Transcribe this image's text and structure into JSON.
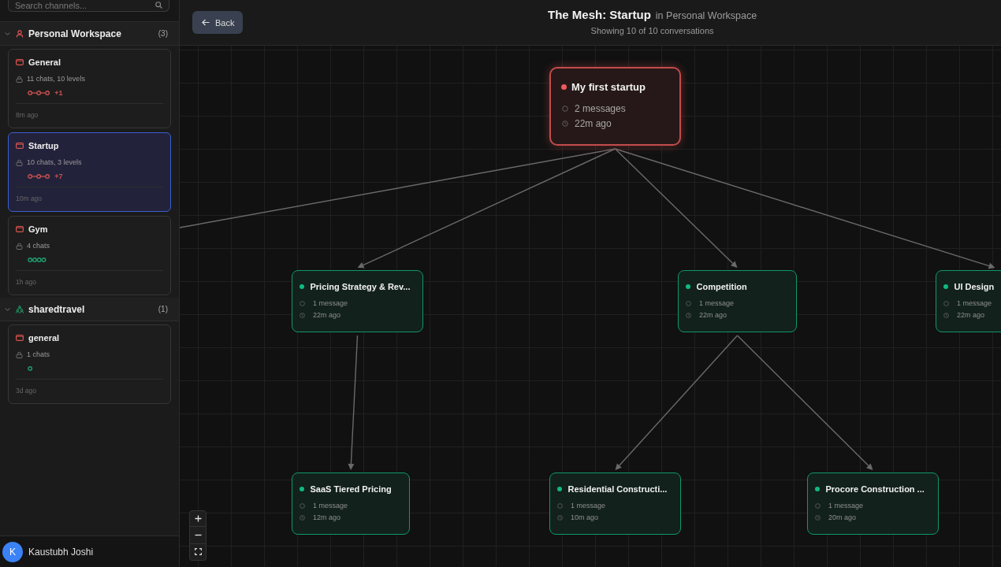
{
  "sidebar": {
    "search": {
      "placeholder": "Search channels..."
    },
    "groups": [
      {
        "kind": "personal",
        "name": "Personal Workspace",
        "count": "(3)",
        "expanded": true,
        "channels": [
          {
            "name": "General",
            "summary": "11 chats, 10 levels",
            "preview": {
              "linked": true,
              "dots": [
                {
                  "color": "#c8504e"
                },
                {
                  "color": "#c8504e"
                },
                {
                  "color": "#c8504e"
                }
              ],
              "extra": "+1"
            },
            "time": "8m ago",
            "selected": false
          },
          {
            "name": "Startup",
            "summary": "10 chats, 3 levels",
            "preview": {
              "linked": true,
              "dots": [
                {
                  "color": "#c8504e"
                },
                {
                  "color": "#c8504e"
                },
                {
                  "color": "#c8504e"
                }
              ],
              "extra": "+7"
            },
            "time": "10m ago",
            "selected": true
          },
          {
            "name": "Gym",
            "summary": "4 chats",
            "preview": {
              "linked": false,
              "dots": [
                {
                  "color": "#1f9d6e"
                },
                {
                  "color": "#1f9d6e"
                },
                {
                  "color": "#1f9d6e"
                },
                {
                  "color": "#1f9d6e"
                }
              ]
            },
            "time": "1h ago",
            "selected": false
          }
        ]
      },
      {
        "kind": "shared",
        "name": "sharedtravel",
        "count": "(1)",
        "expanded": true,
        "channels": [
          {
            "name": "general",
            "summary": "1 chats",
            "preview": {
              "linked": false,
              "dots": [
                {
                  "color": "#1f9d6e"
                }
              ]
            },
            "time": "3d ago",
            "selected": false
          }
        ]
      }
    ],
    "user": {
      "initial": "K",
      "name": "Kaustubh Joshi"
    }
  },
  "main": {
    "back_button": {
      "label": "Back"
    },
    "title": "The Mesh: Startup",
    "context": "in Personal Workspace",
    "subtitle": "Showing 10 of 10 conversations",
    "mesh": {
      "nodes": [
        {
          "title": "My first startup",
          "messages": "2 messages",
          "time": "22m ago",
          "color": "#f05a5a",
          "children": [
            {
              "title": "Pricing Strategy & Rev...",
              "messages": "1 message",
              "time": "22m ago",
              "color": "#10b981",
              "children": [
                {
                  "title": "SaaS Tiered Pricing",
                  "messages": "1 message",
                  "time": "12m ago",
                  "color": "#10b981"
                }
              ]
            },
            {
              "title": "Competition",
              "messages": "1 message",
              "time": "22m ago",
              "color": "#10b981",
              "children": [
                {
                  "title": "Residential Constructi...",
                  "messages": "1 message",
                  "time": "10m ago",
                  "color": "#10b981"
                },
                {
                  "title": "Procore Construction ...",
                  "messages": "1 message",
                  "time": "20m ago",
                  "color": "#10b981"
                }
              ]
            },
            {
              "title": "UI Design",
              "messages": "1 message",
              "time": "22m ago",
              "color": "#10b981"
            }
          ]
        }
      ]
    }
  }
}
